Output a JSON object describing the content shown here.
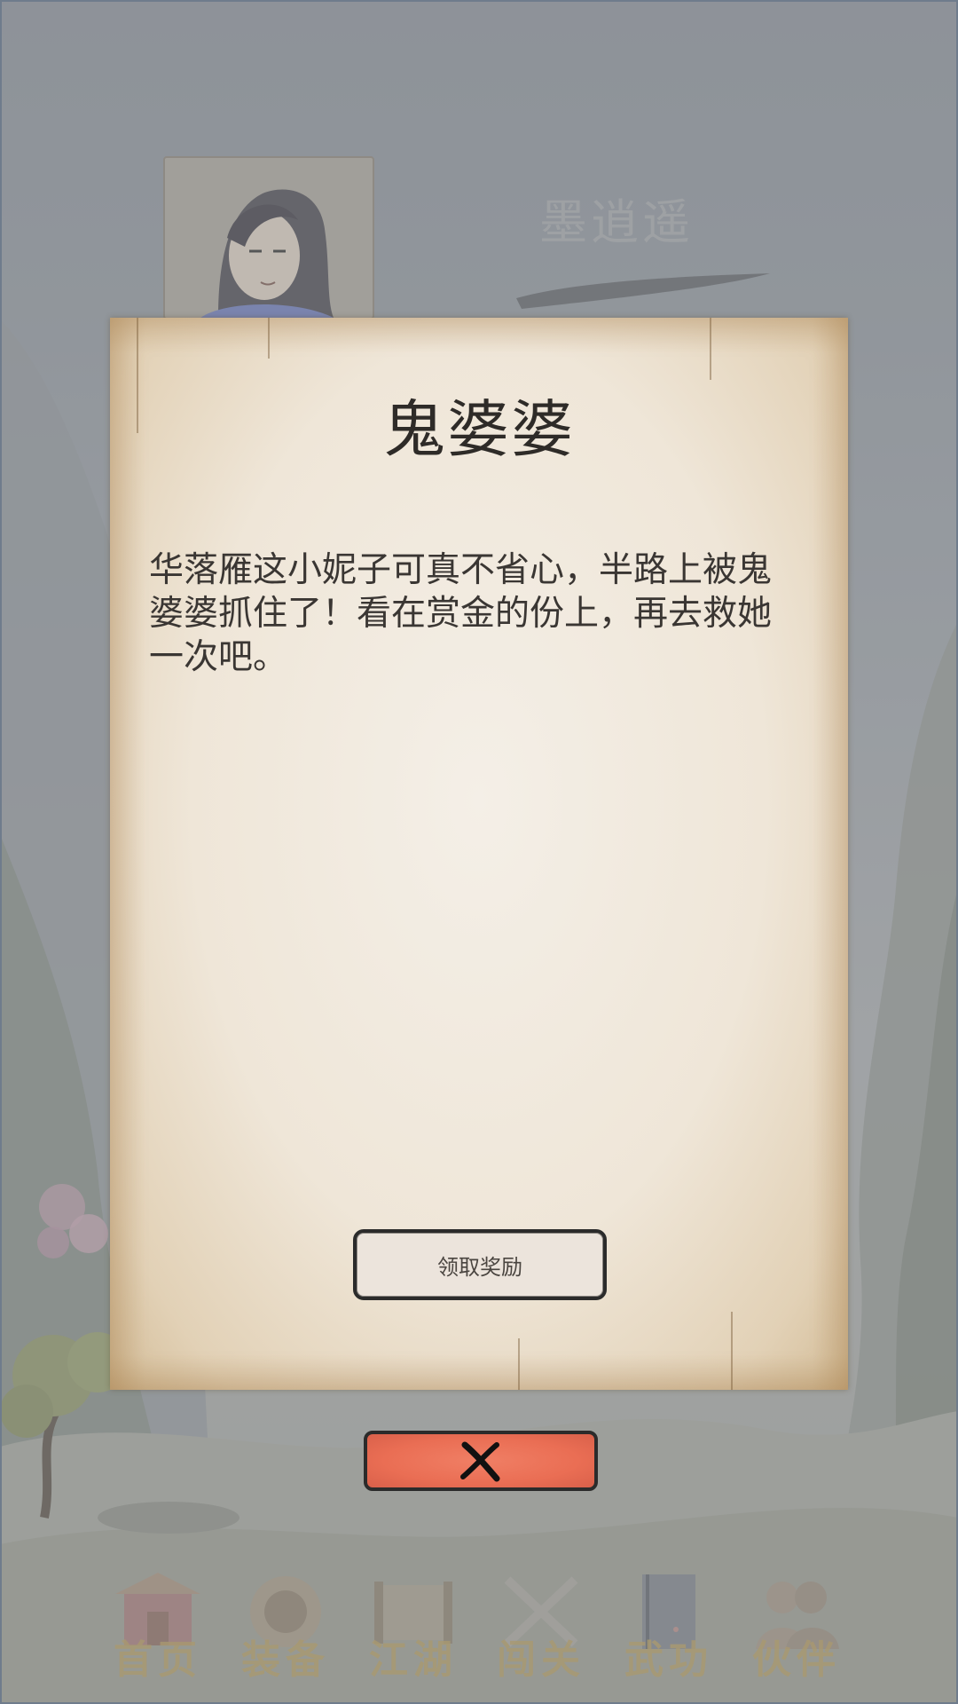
{
  "background": {
    "character_name": "墨逍遥"
  },
  "nav": {
    "items": [
      {
        "label": "首页",
        "icon": "gate-icon"
      },
      {
        "label": "装备",
        "icon": "armor-icon"
      },
      {
        "label": "江湖",
        "icon": "scroll-icon"
      },
      {
        "label": "闯关",
        "icon": "swords-icon"
      },
      {
        "label": "武功",
        "icon": "book-icon"
      },
      {
        "label": "伙伴",
        "icon": "people-icon"
      }
    ]
  },
  "dialog": {
    "title": "鬼婆婆",
    "body": "华落雁这小妮子可真不省心，半路上被鬼婆婆抓住了！看在赏金的份上，再去救她一次吧。",
    "reward_button": "领取奖励",
    "close_icon": "close-icon"
  },
  "colors": {
    "paper": "#efe6d8",
    "close_button": "#ea6e54",
    "nav_label": "#b49a5a"
  }
}
